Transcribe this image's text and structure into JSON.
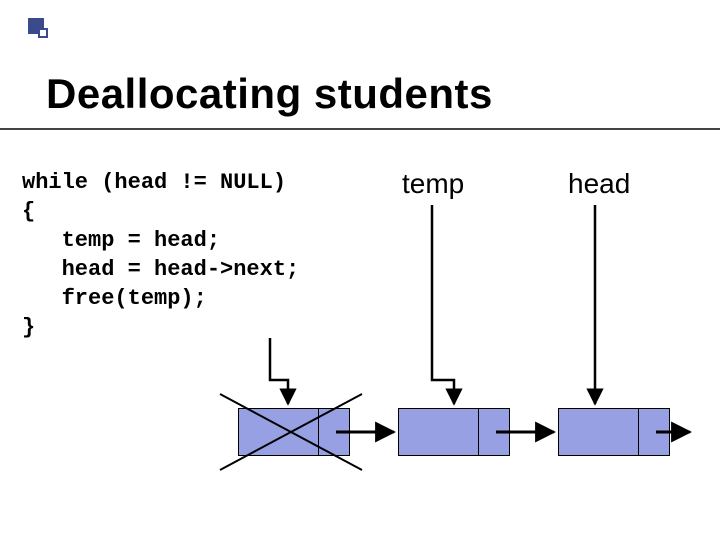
{
  "slide": {
    "title": "Deallocating students",
    "code_lines": [
      "while (head != NULL)",
      "{",
      "   temp = head;",
      "   head = head->next;",
      "   free(temp);",
      "}"
    ],
    "pointers": {
      "temp": "temp",
      "head": "head"
    }
  },
  "chart_data": {
    "type": "diagram",
    "description": "Singly linked list with three nodes. Node 1 is crossed out (freed). 'temp' points to node 2, 'head' points to node 3. Each node's next-pointer field points to the following node; node 3's next points to NULL (off-list).",
    "nodes": [
      {
        "id": 1,
        "freed": true,
        "next": 2
      },
      {
        "id": 2,
        "freed": false,
        "next": 3
      },
      {
        "id": 3,
        "freed": false,
        "next": null
      }
    ],
    "pointers": {
      "temp": 2,
      "head": 3
    }
  }
}
